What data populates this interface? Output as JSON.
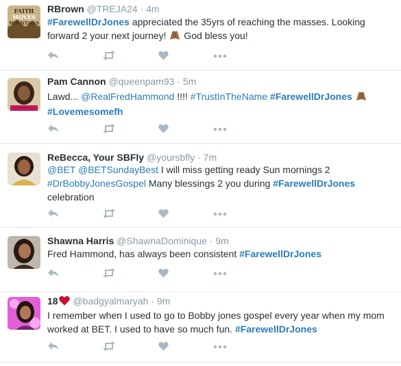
{
  "colors": {
    "link": "#2b7bb9",
    "icon": "#aab8c2",
    "meta": "#8899a6",
    "divider": "#e1e8ed"
  },
  "icons": {
    "reply": "reply-icon",
    "retweet": "retweet-icon",
    "like": "heart-icon",
    "more": "more-icon"
  },
  "tweets": [
    {
      "name": "RBrown",
      "handle": "@TREJA24",
      "separator": "·",
      "time": "4m",
      "avatar_text": [
        "FAITH",
        "MOVES",
        "MOUNTAINS"
      ],
      "text": {
        "hashtag1": "#FarewellDrJones",
        "t1": " appreciated the 35yrs of reaching the masses. Looking forward 2 your next journey! ",
        "t2": " God bless you!"
      }
    },
    {
      "name": "Pam Cannon",
      "handle": "@queenpam93",
      "separator": "·",
      "time": "5m",
      "text": {
        "t1": "Lawd... ",
        "mention1": "@RealFredHammond",
        "t2": " !!!! ",
        "hashtag1": "#TrustInTheName",
        "t3": " ",
        "hashtag2": "#FarewellDrJones",
        "hashtag3": "#Lovemesomefh"
      }
    },
    {
      "name": "ReBecca, Your SBFly",
      "handle": "@yoursbfly",
      "separator": "·",
      "time": "7m",
      "text": {
        "mention1": "@BET",
        "t1": " ",
        "mention2": "@BETSundayBest",
        "t2": " I will miss getting ready Sun mornings 2",
        "hashtag1": "#DrBobbyJonesGospel",
        "t3": " Many blessings 2 you during  ",
        "hashtag2": "#FarewellDrJones",
        "t4": "celebration"
      }
    },
    {
      "name": "Shawna Harris",
      "handle": "@ShawnaDominique",
      "separator": "·",
      "time": "9m",
      "text": {
        "t1": "Fred Hammond, has always been consistent  ",
        "hashtag1": "#FarewellDrJones"
      }
    },
    {
      "name": "18",
      "handle": "@badgyalmaryah",
      "separator": "·",
      "time": "9m",
      "text": {
        "t1": "I remember when I used to go to Bobby jones gospel every year when my mom worked at BET. I used to have so much fun. ",
        "hashtag1": "#FarewellDrJones"
      }
    }
  ]
}
